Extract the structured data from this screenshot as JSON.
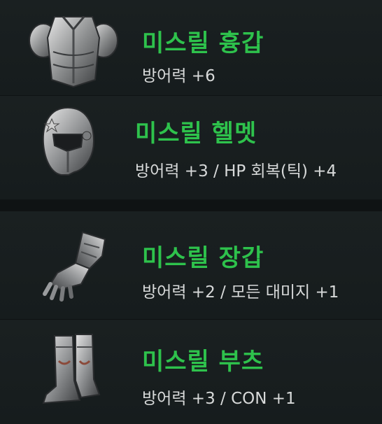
{
  "items": [
    {
      "name": "미스릴 흉갑",
      "stat": "방어력 +6",
      "icon": "chest-armor-icon"
    },
    {
      "name": "미스릴 헬멧",
      "stat": "방어력 +3 / HP 회복(틱) +4",
      "icon": "helmet-icon"
    },
    {
      "name": "미스릴 장갑",
      "stat": "방어력 +2 / 모든 대미지 +1",
      "icon": "gauntlet-icon"
    },
    {
      "name": "미스릴 부츠",
      "stat": "방어력 +3 / CON +1",
      "icon": "boots-icon"
    }
  ],
  "colors": {
    "item_name": "#2ec24c",
    "stat_text": "#d7d9d9",
    "background": "#151b1c"
  }
}
